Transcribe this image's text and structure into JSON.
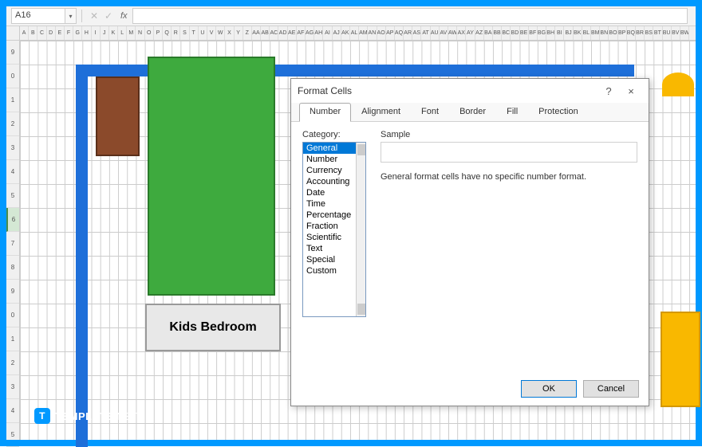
{
  "nameBox": "A16",
  "fxLabel": "fx",
  "colHeaders": [
    "A",
    "B",
    "C",
    "D",
    "E",
    "F",
    "G",
    "H",
    "I",
    "J",
    "K",
    "L",
    "M",
    "N",
    "O",
    "P",
    "Q",
    "R",
    "S",
    "T",
    "U",
    "V",
    "W",
    "X",
    "Y",
    "Z",
    "AA",
    "AB",
    "AC",
    "AD",
    "AE",
    "AF",
    "AG",
    "AH",
    "AI",
    "AJ",
    "AK",
    "AL",
    "AM",
    "AN",
    "AO",
    "AP",
    "AQ",
    "AR",
    "AS",
    "AT",
    "AU",
    "AV",
    "AW",
    "AX",
    "AY",
    "AZ",
    "BA",
    "BB",
    "BC",
    "BD",
    "BE",
    "BF",
    "BG",
    "BH",
    "BI",
    "BJ",
    "BK",
    "BL",
    "BM",
    "BN",
    "BO",
    "BP",
    "BQ",
    "BR",
    "BS",
    "BT",
    "BU",
    "BV",
    "BW"
  ],
  "rowHeaders": [
    "9",
    "0",
    "1",
    "2",
    "3",
    "4",
    "5",
    "6",
    "7",
    "8",
    "9",
    "0",
    "1",
    "2",
    "3",
    "4",
    "5"
  ],
  "selectedRowIndex": 7,
  "roomLabel": "Kids Bedroom",
  "dialog": {
    "title": "Format Cells",
    "help": "?",
    "close": "×",
    "tabs": [
      "Number",
      "Alignment",
      "Font",
      "Border",
      "Fill",
      "Protection"
    ],
    "activeTab": 0,
    "categoryLabel": "Category:",
    "categories": [
      "General",
      "Number",
      "Currency",
      "Accounting",
      "Date",
      "Time",
      "Percentage",
      "Fraction",
      "Scientific",
      "Text",
      "Special",
      "Custom"
    ],
    "selectedCategory": 0,
    "sampleLabel": "Sample",
    "description": "General format cells have no specific number format.",
    "okLabel": "OK",
    "cancelLabel": "Cancel"
  },
  "watermark": {
    "icon": "T",
    "text1": "TEMPLATE",
    "text2": ".NET"
  }
}
